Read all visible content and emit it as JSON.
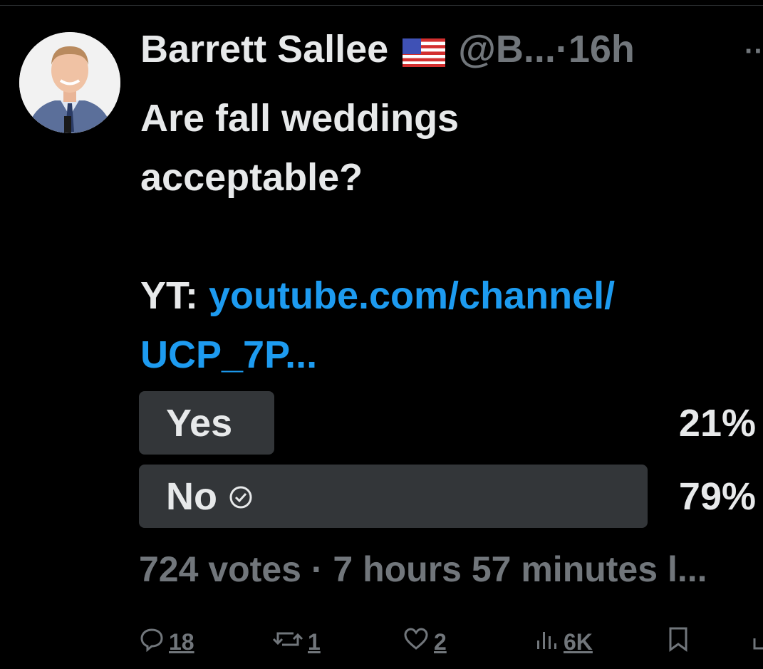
{
  "tweet": {
    "author_name": "Barrett Sallee",
    "handle": "@B...",
    "separator": "·",
    "time": "16h",
    "text_lines": [
      "Are fall weddings",
      "acceptable?"
    ],
    "yt_prefix": "YT: ",
    "link_lines": [
      "youtube.com/channel/",
      "UCP_7P..."
    ]
  },
  "poll": {
    "options": [
      {
        "label": "Yes",
        "percent": "21%",
        "fill_fraction": 0.21,
        "selected": false
      },
      {
        "label": "No",
        "percent": "79%",
        "fill_fraction": 0.79,
        "selected": true
      }
    ],
    "meta": "724 votes · 7 hours 57 minutes l..."
  },
  "actions": {
    "replies": "18",
    "reposts": "1",
    "likes": "2",
    "views": "6K"
  },
  "icons": {
    "reply": "reply-icon",
    "repost": "repost-icon",
    "like": "heart-icon",
    "views": "views-icon",
    "bookmark": "bookmark-icon",
    "share": "share-icon",
    "more": "more-icon"
  },
  "colors": {
    "background": "#000000",
    "text": "#e7e9ea",
    "muted": "#71767b",
    "link": "#1d9bf0",
    "poll_bar": "#333639"
  }
}
